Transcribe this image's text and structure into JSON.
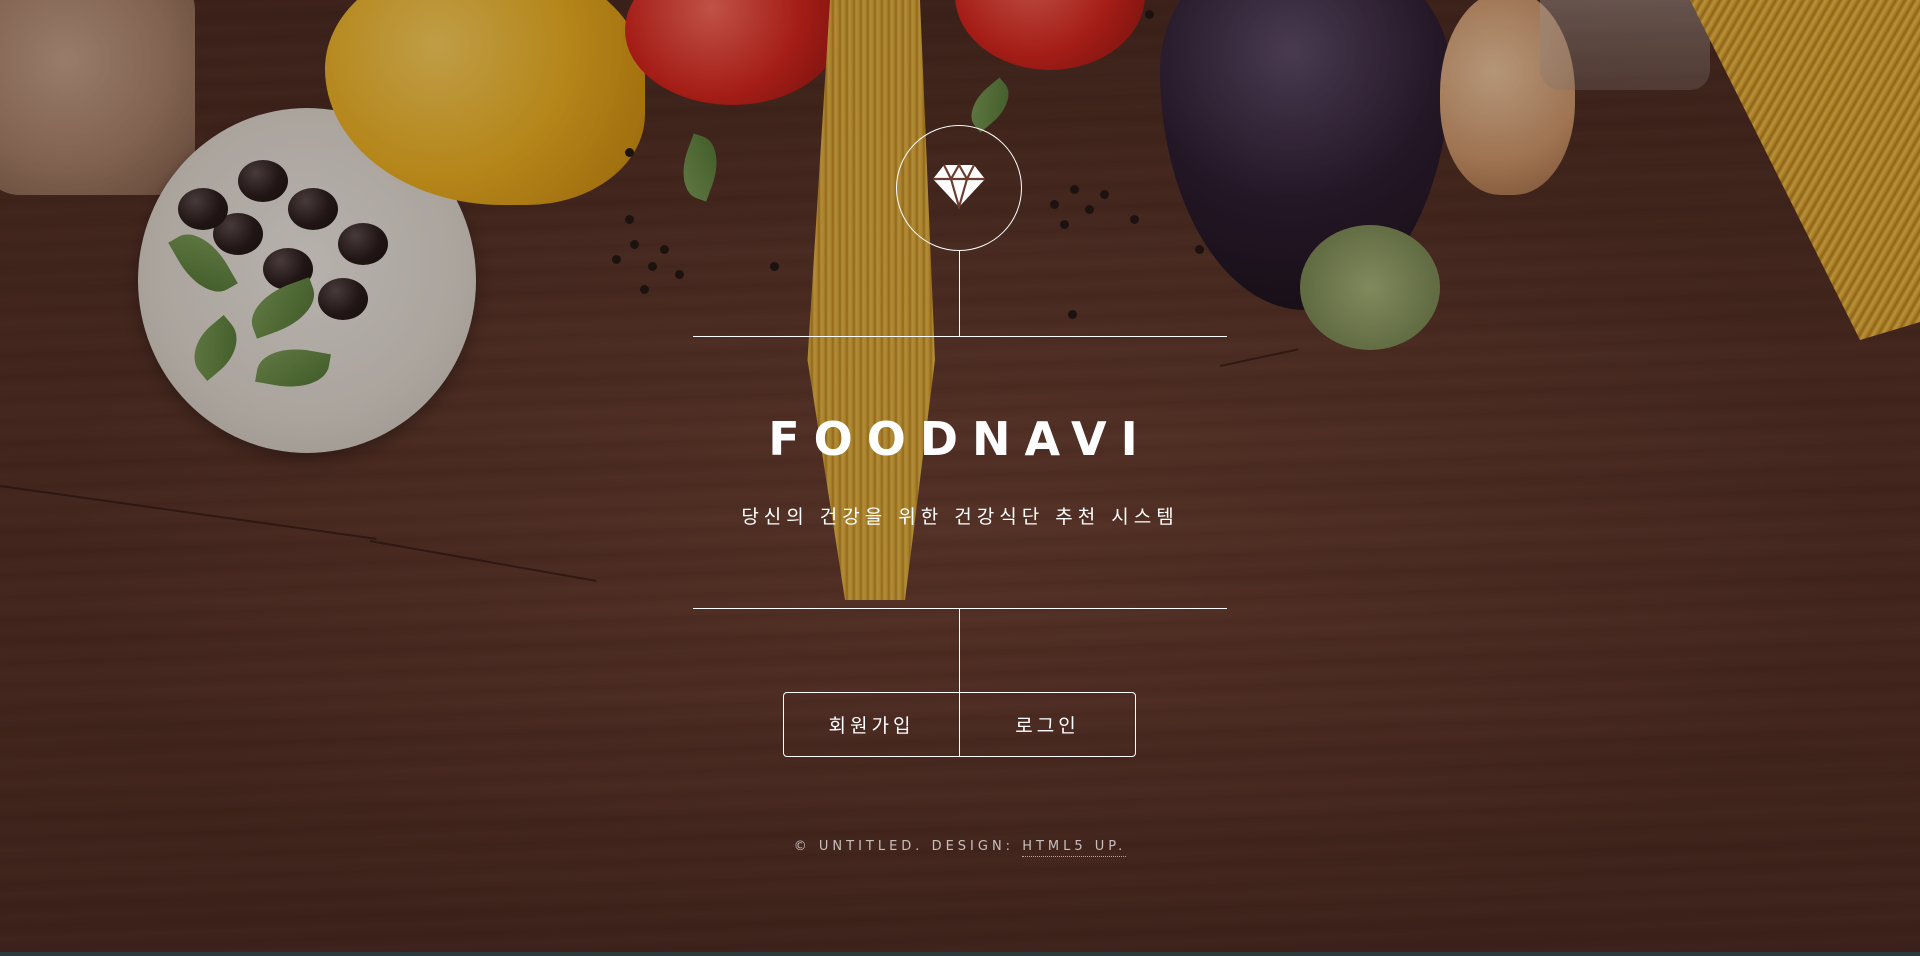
{
  "header": {
    "logo_icon": "diamond-icon",
    "title": "FOODNAVI",
    "subtitle": "당신의 건강을 위한 건강식단 추천 시스템"
  },
  "nav": {
    "items": [
      {
        "label": "회원가입"
      },
      {
        "label": "로그인"
      }
    ]
  },
  "footer": {
    "copyright": "© UNTITLED. DESIGN:",
    "link_label": "HTML5 UP."
  },
  "colors": {
    "text": "#ffffff",
    "background_wood": "#6a3d30"
  }
}
